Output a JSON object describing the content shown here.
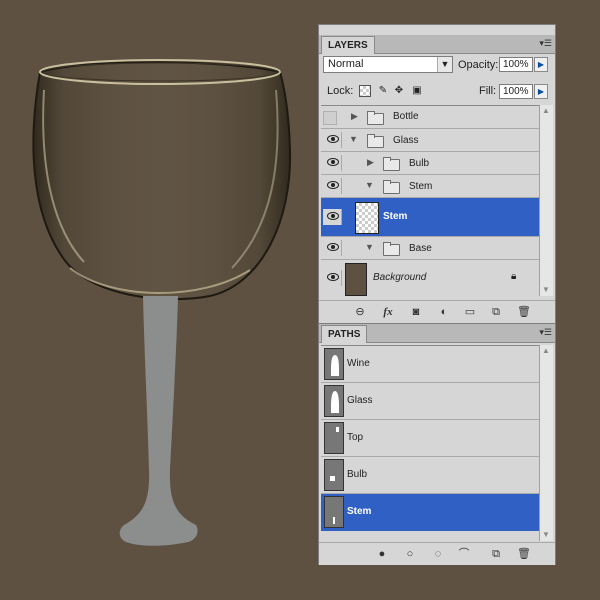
{
  "colors": {
    "desktop": "#5e5141",
    "panel": "#d6d6d6",
    "selection": "#3060c4",
    "glass_stem": "#8c8d8d",
    "bg_layer_thumb": "#5e5141"
  },
  "layers_panel": {
    "tab": "LAYERS",
    "blend_mode": "Normal",
    "opacity_label": "Opacity:",
    "opacity_value": "100%",
    "lock_label": "Lock:",
    "fill_label": "Fill:",
    "fill_value": "100%",
    "layers": [
      {
        "name": "Bottle",
        "type": "group",
        "expanded": false,
        "visible": false,
        "indent": 0,
        "selected": false
      },
      {
        "name": "Glass",
        "type": "group",
        "expanded": true,
        "visible": true,
        "indent": 0,
        "selected": false
      },
      {
        "name": "Bulb",
        "type": "group",
        "expanded": false,
        "visible": true,
        "indent": 1,
        "selected": false
      },
      {
        "name": "Stem",
        "type": "group",
        "expanded": true,
        "visible": true,
        "indent": 1,
        "selected": false
      },
      {
        "name": "Stem",
        "type": "layer",
        "visible": true,
        "indent": 2,
        "selected": true
      },
      {
        "name": "Base",
        "type": "group",
        "expanded": true,
        "visible": true,
        "indent": 1,
        "selected": false
      },
      {
        "name": "Background",
        "type": "background",
        "visible": true,
        "locked": true,
        "selected": false
      }
    ],
    "footer_icons": [
      "link-icon",
      "fx-icon",
      "mask-icon",
      "adjustment-icon",
      "new-group-icon",
      "new-layer-icon",
      "trash-icon"
    ]
  },
  "paths_panel": {
    "tab": "PATHS",
    "paths": [
      {
        "name": "Wine",
        "selected": false
      },
      {
        "name": "Glass",
        "selected": false
      },
      {
        "name": "Top",
        "selected": false
      },
      {
        "name": "Bulb",
        "selected": false
      },
      {
        "name": "Stem",
        "selected": true
      }
    ],
    "footer_icons": [
      "fill-path-icon",
      "stroke-path-icon",
      "load-selection-icon",
      "make-path-icon",
      "new-path-icon",
      "trash-icon"
    ]
  }
}
